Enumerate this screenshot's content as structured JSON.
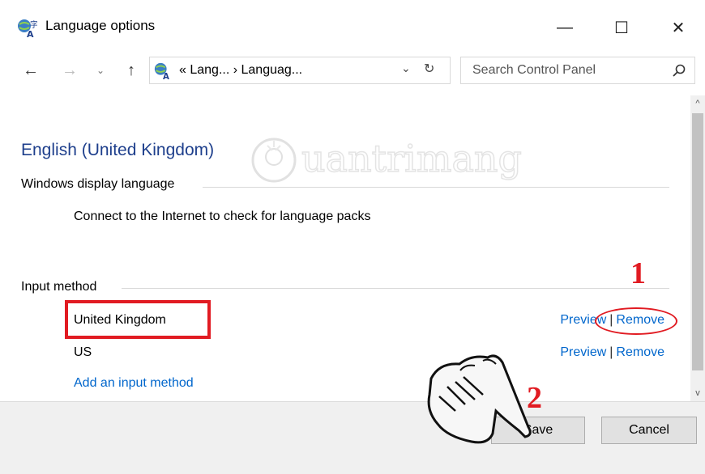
{
  "window": {
    "title": "Language options",
    "icon": "language-globe-icon",
    "controls": {
      "minimize": "—",
      "maximize": "☐",
      "close": "✕"
    }
  },
  "nav": {
    "back": "←",
    "forward": "→",
    "recent": "⌄",
    "up": "↑",
    "address": "« Lang... › Languag...",
    "address_dropdown": "⌄",
    "refresh": "↻",
    "search_placeholder": "Search Control Panel"
  },
  "content": {
    "language_title": "English (United Kingdom)",
    "display_language_label": "Windows display language",
    "display_language_info": "Connect to the Internet to check for language packs",
    "input_method_label": "Input method",
    "input_methods": [
      {
        "name": "United Kingdom",
        "preview": "Preview",
        "separator": "|",
        "remove": "Remove"
      },
      {
        "name": "US",
        "preview": "Preview",
        "separator": "|",
        "remove": "Remove"
      }
    ],
    "add_input_method": "Add an input method"
  },
  "annotations": {
    "step1": "1",
    "step2": "2",
    "accent_color": "#e11b22"
  },
  "watermark": {
    "text": "uantrimang"
  },
  "footer": {
    "save": "Save",
    "cancel": "Cancel"
  },
  "scrollbar": {
    "up": "^",
    "down": "v"
  }
}
